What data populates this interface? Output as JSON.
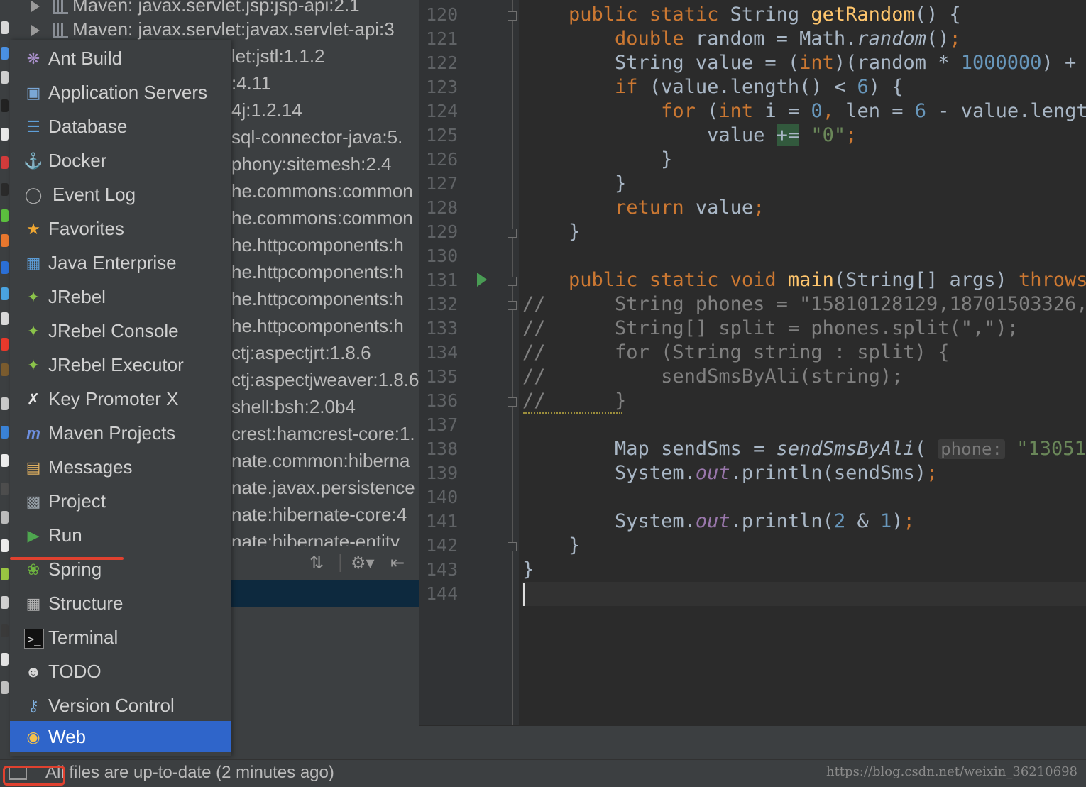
{
  "tree": {
    "top_rows": [
      "Maven: javax.servlet.jsp:jsp-api:2.1",
      "Maven: javax.servlet:javax.servlet-api:3"
    ],
    "rows": [
      "let:jstl:1.1.2",
      ":4.11",
      "4j:1.2.14",
      "sql-connector-java:5.",
      "phony:sitemesh:2.4",
      "he.commons:common",
      "he.commons:common",
      "he.httpcomponents:h",
      "he.httpcomponents:h",
      "he.httpcomponents:h",
      "he.httpcomponents:h",
      "ctj:aspectjrt:1.8.6",
      "ctj:aspectjweaver:1.8.6",
      "shell:bsh:2.0b4",
      "crest:hamcrest-core:1.",
      "nate.common:hiberna",
      "nate.javax.persistence",
      "nate:hibernate-core:4",
      "nate:hibernate-entity"
    ]
  },
  "popup": {
    "items": [
      {
        "label": "Ant Build",
        "icon": "ant-icon"
      },
      {
        "label": "Application Servers",
        "icon": "application-servers-icon"
      },
      {
        "label": "Database",
        "icon": "database-icon"
      },
      {
        "label": "Docker",
        "icon": "docker-icon"
      },
      {
        "label": "Event Log",
        "icon": "event-log-icon"
      },
      {
        "label": "Favorites",
        "icon": "star-icon"
      },
      {
        "label": "Java Enterprise",
        "icon": "java-enterprise-icon"
      },
      {
        "label": "JRebel",
        "icon": "jrebel-icon"
      },
      {
        "label": "JRebel Console",
        "icon": "jrebel-icon"
      },
      {
        "label": "JRebel Executor",
        "icon": "jrebel-icon"
      },
      {
        "label": "Key Promoter X",
        "icon": "key-promoter-icon"
      },
      {
        "label": "Maven Projects",
        "icon": "maven-icon"
      },
      {
        "label": "Messages",
        "icon": "messages-icon"
      },
      {
        "label": "Project",
        "icon": "project-icon"
      },
      {
        "label": "Run",
        "icon": "run-icon"
      },
      {
        "label": "Spring",
        "icon": "spring-icon"
      },
      {
        "label": "Structure",
        "icon": "structure-icon"
      },
      {
        "label": "Terminal",
        "icon": "terminal-icon"
      },
      {
        "label": "TODO",
        "icon": "todo-icon"
      },
      {
        "label": "Version Control",
        "icon": "version-control-icon"
      },
      {
        "label": "Web",
        "icon": "web-icon"
      }
    ],
    "selected": "Web"
  },
  "editor": {
    "line_numbers": [
      "120",
      "121",
      "122",
      "123",
      "124",
      "125",
      "126",
      "127",
      "128",
      "129",
      "130",
      "131",
      "132",
      "133",
      "134",
      "135",
      "136",
      "137",
      "138",
      "139",
      "140",
      "141",
      "142",
      "143",
      "144"
    ]
  },
  "status": {
    "text": "All files are up-to-date (2 minutes ago)",
    "watermark": "https://blog.csdn.net/weixin_36210698"
  },
  "colors": {
    "popup_selected": "#2f65ca",
    "highlight_red": "#e0412f",
    "keyword": "#cc7832",
    "string": "#6a8759",
    "number": "#6897bb",
    "function": "#ffc66d"
  }
}
